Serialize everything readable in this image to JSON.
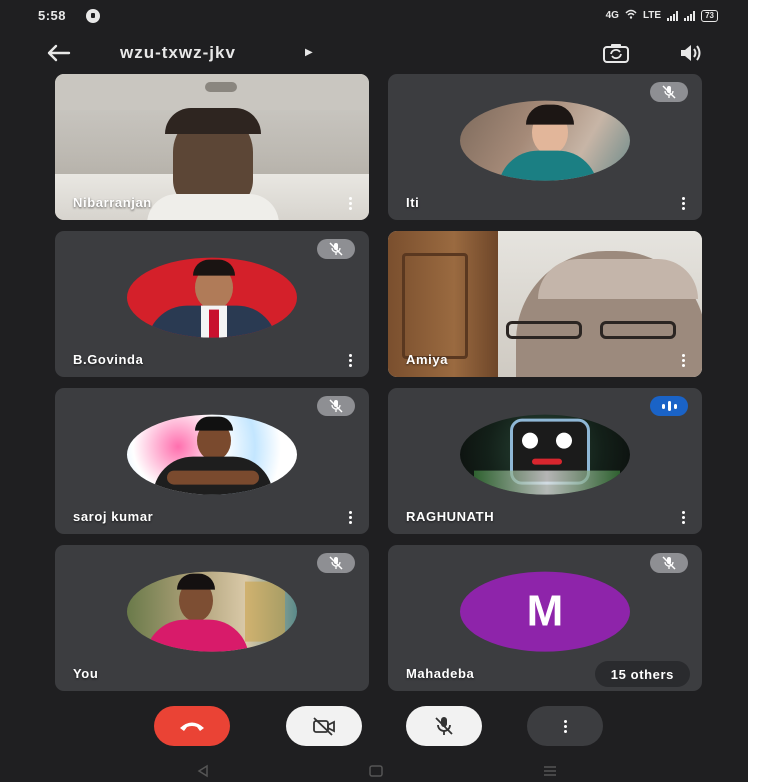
{
  "status_bar": {
    "time": "5:58",
    "network_left": "4G",
    "network_right": "LTE",
    "battery": "73"
  },
  "header": {
    "meeting_code": "wzu-txwz-jkv"
  },
  "participants": [
    {
      "name": "Nibarranjan",
      "muted": false,
      "type": "video"
    },
    {
      "name": "Iti",
      "muted": true,
      "type": "photo"
    },
    {
      "name": "B.Govinda",
      "muted": true,
      "type": "photo"
    },
    {
      "name": "Amiya",
      "muted": false,
      "type": "video"
    },
    {
      "name": "saroj kumar",
      "muted": true,
      "type": "photo"
    },
    {
      "name": "RAGHUNATH",
      "muted": false,
      "speaking": true,
      "type": "photo"
    },
    {
      "name": "You",
      "muted": true,
      "type": "photo"
    },
    {
      "name": "Mahadeba",
      "muted": true,
      "type": "letter",
      "initial": "M",
      "avatar_color": "#8e24aa"
    }
  ],
  "others_chip": "15 others",
  "colors": {
    "background": "#1f1f21",
    "tile": "#3c3d40",
    "end_call": "#ea4335",
    "speaking": "#1a63c7"
  },
  "icons": {
    "back": "arrow-left-icon",
    "camera_switch": "camera-switch-icon",
    "speaker": "speaker-icon",
    "end_call": "phone-hangup-icon",
    "camera_off": "video-off-icon",
    "mic_off": "mic-off-icon",
    "more": "more-vertical-icon"
  }
}
